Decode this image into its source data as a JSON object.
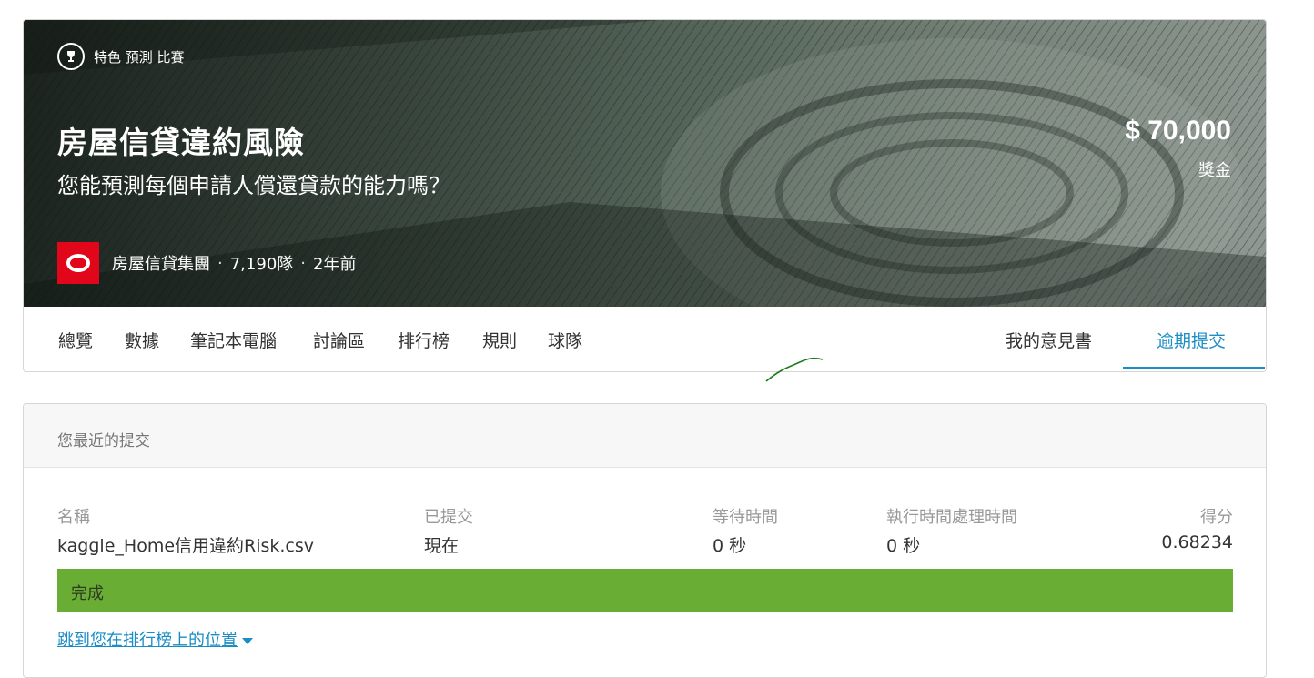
{
  "competition": {
    "badge": "特色 預測 比賽",
    "title": "房屋信貸違約風險",
    "subtitle": "您能預測每個申請人償還貸款的能力嗎？",
    "host": "房屋信貸集團",
    "teams": "7,190隊",
    "age": "2年前",
    "prize_amount": "$ 70,000",
    "prize_label": "獎金"
  },
  "tabs": [
    {
      "label": "總覽"
    },
    {
      "label": "數據"
    },
    {
      "label": "筆記本電腦"
    },
    {
      "label": "討論區"
    },
    {
      "label": "排行榜"
    },
    {
      "label": "規則"
    },
    {
      "label": "球隊"
    }
  ],
  "right_tabs": [
    {
      "label": "我的意見書"
    },
    {
      "label": "逾期提交",
      "active": true
    }
  ],
  "submission": {
    "header": "您最近的提交",
    "columns": {
      "name": "名稱",
      "submitted": "已提交",
      "wait_time": "等待時間",
      "run_time": "執行時間處理時間",
      "score": "得分"
    },
    "values": {
      "name": "kaggle_Home信用違約Risk.csv",
      "submitted": "現在",
      "wait_time": "0 秒",
      "run_time": "0 秒",
      "score": "0.68234"
    },
    "status": "完成",
    "jump_link": "跳到您在排行榜上的位置"
  },
  "colors": {
    "accent": "#1b8dc4",
    "success": "#6aad35",
    "host_logo": "#e1061a"
  }
}
